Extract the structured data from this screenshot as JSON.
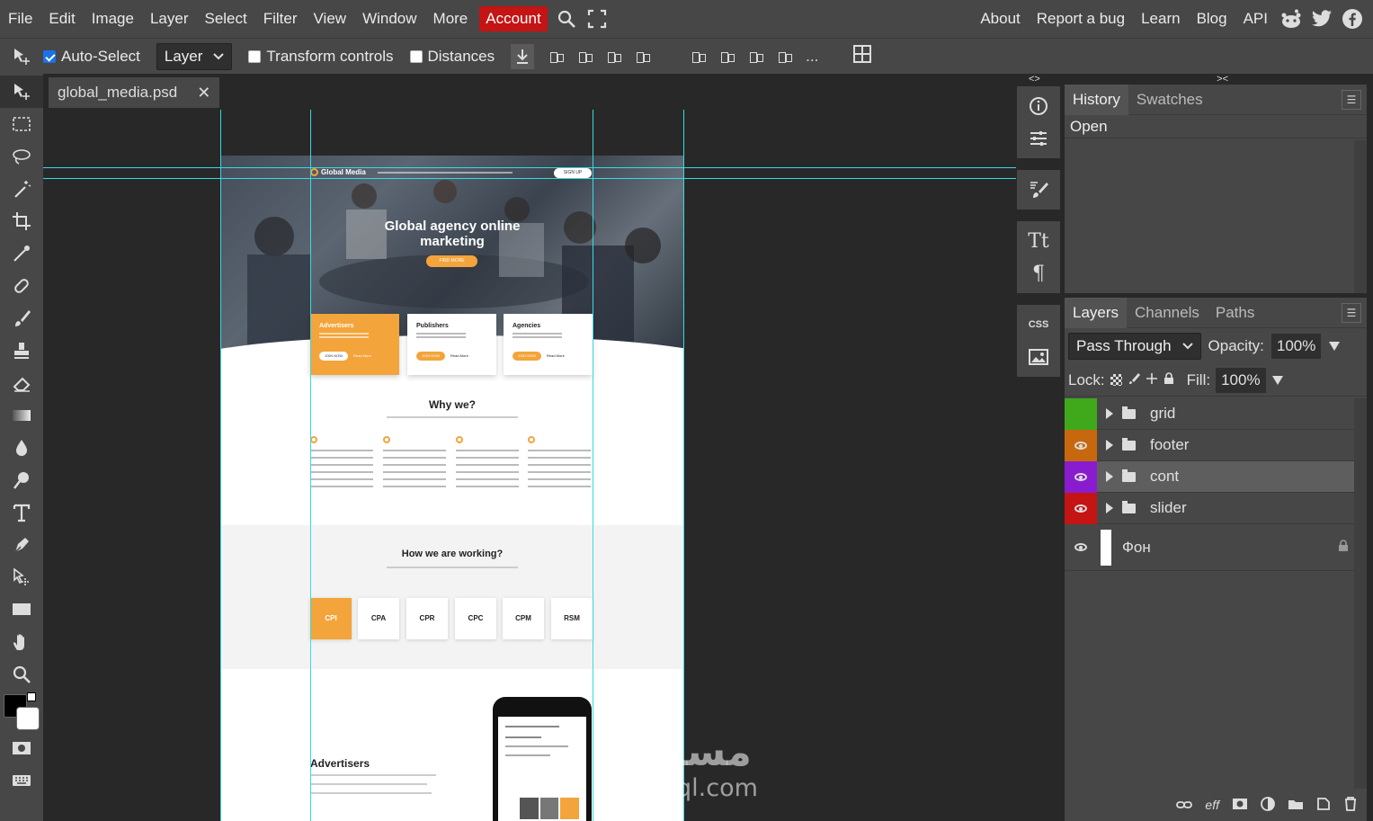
{
  "menu": {
    "items": [
      "File",
      "Edit",
      "Image",
      "Layer",
      "Select",
      "Filter",
      "View",
      "Window",
      "More"
    ],
    "account": "Account",
    "right": [
      "About",
      "Report a bug",
      "Learn",
      "Blog",
      "API"
    ]
  },
  "options": {
    "auto_select_label": "Auto-Select",
    "auto_select_checked": true,
    "layer_select_value": "Layer",
    "transform_controls_label": "Transform controls",
    "distances_label": "Distances",
    "more": "..."
  },
  "document": {
    "tab_name": "global_media.psd",
    "close": "✕"
  },
  "mini_panel": {
    "collapse_left": "<>",
    "collapse_right": "><",
    "css_label": "CSS",
    "text_label": "Tt",
    "para_label": "¶"
  },
  "history": {
    "tabs": [
      "History",
      "Swatches"
    ],
    "entries": [
      "Open"
    ]
  },
  "layers_panel": {
    "tabs": [
      "Layers",
      "Channels",
      "Paths"
    ],
    "blend_mode": "Pass Through",
    "opacity_label": "Opacity:",
    "opacity_value": "100%",
    "lock_label": "Lock:",
    "fill_label": "Fill:",
    "fill_value": "100%",
    "layers": [
      {
        "name": "grid",
        "color": "#3fa91b",
        "visible": false,
        "type": "folder"
      },
      {
        "name": "footer",
        "color": "#c7680f",
        "visible": true,
        "type": "folder"
      },
      {
        "name": "cont",
        "color": "#8a1cd0",
        "visible": true,
        "type": "folder",
        "selected": true
      },
      {
        "name": "slider",
        "color": "#c41414",
        "visible": true,
        "type": "folder"
      },
      {
        "name": "Фон",
        "color": "",
        "visible": true,
        "type": "background",
        "locked": true
      }
    ],
    "bottom_icons": [
      "link-icon",
      "eff",
      "mask-icon",
      "adjustment-icon",
      "folder-icon",
      "new-layer-icon",
      "trash-icon"
    ],
    "effects_label": "eff"
  },
  "design": {
    "logo": "Global Media",
    "nav_button": "SIGN UP",
    "hero_title": "Global agency online marketing",
    "hero_button": "FIND MORE",
    "cards": [
      {
        "title": "Advertisers",
        "button": "JOIN NOW",
        "link": "Read More"
      },
      {
        "title": "Publishers",
        "button": "JOIN NOW",
        "link": "Read More"
      },
      {
        "title": "Agencies",
        "button": "JOIN NOW",
        "link": "Read More"
      }
    ],
    "why_title": "Why we?",
    "working_title": "How we are working?",
    "models": [
      "CPI",
      "CPA",
      "CPR",
      "CPC",
      "CPM",
      "RSM"
    ],
    "advertisers_title": "Advertisers"
  },
  "colors": {
    "accent": "#f3a43a",
    "guide": "#36dbe4",
    "account_red": "#c41414",
    "panel_bg": "#474747",
    "workspace_bg": "#282828"
  },
  "watermark": {
    "arabic": "مستقل",
    "latin": "mostaql.com"
  }
}
